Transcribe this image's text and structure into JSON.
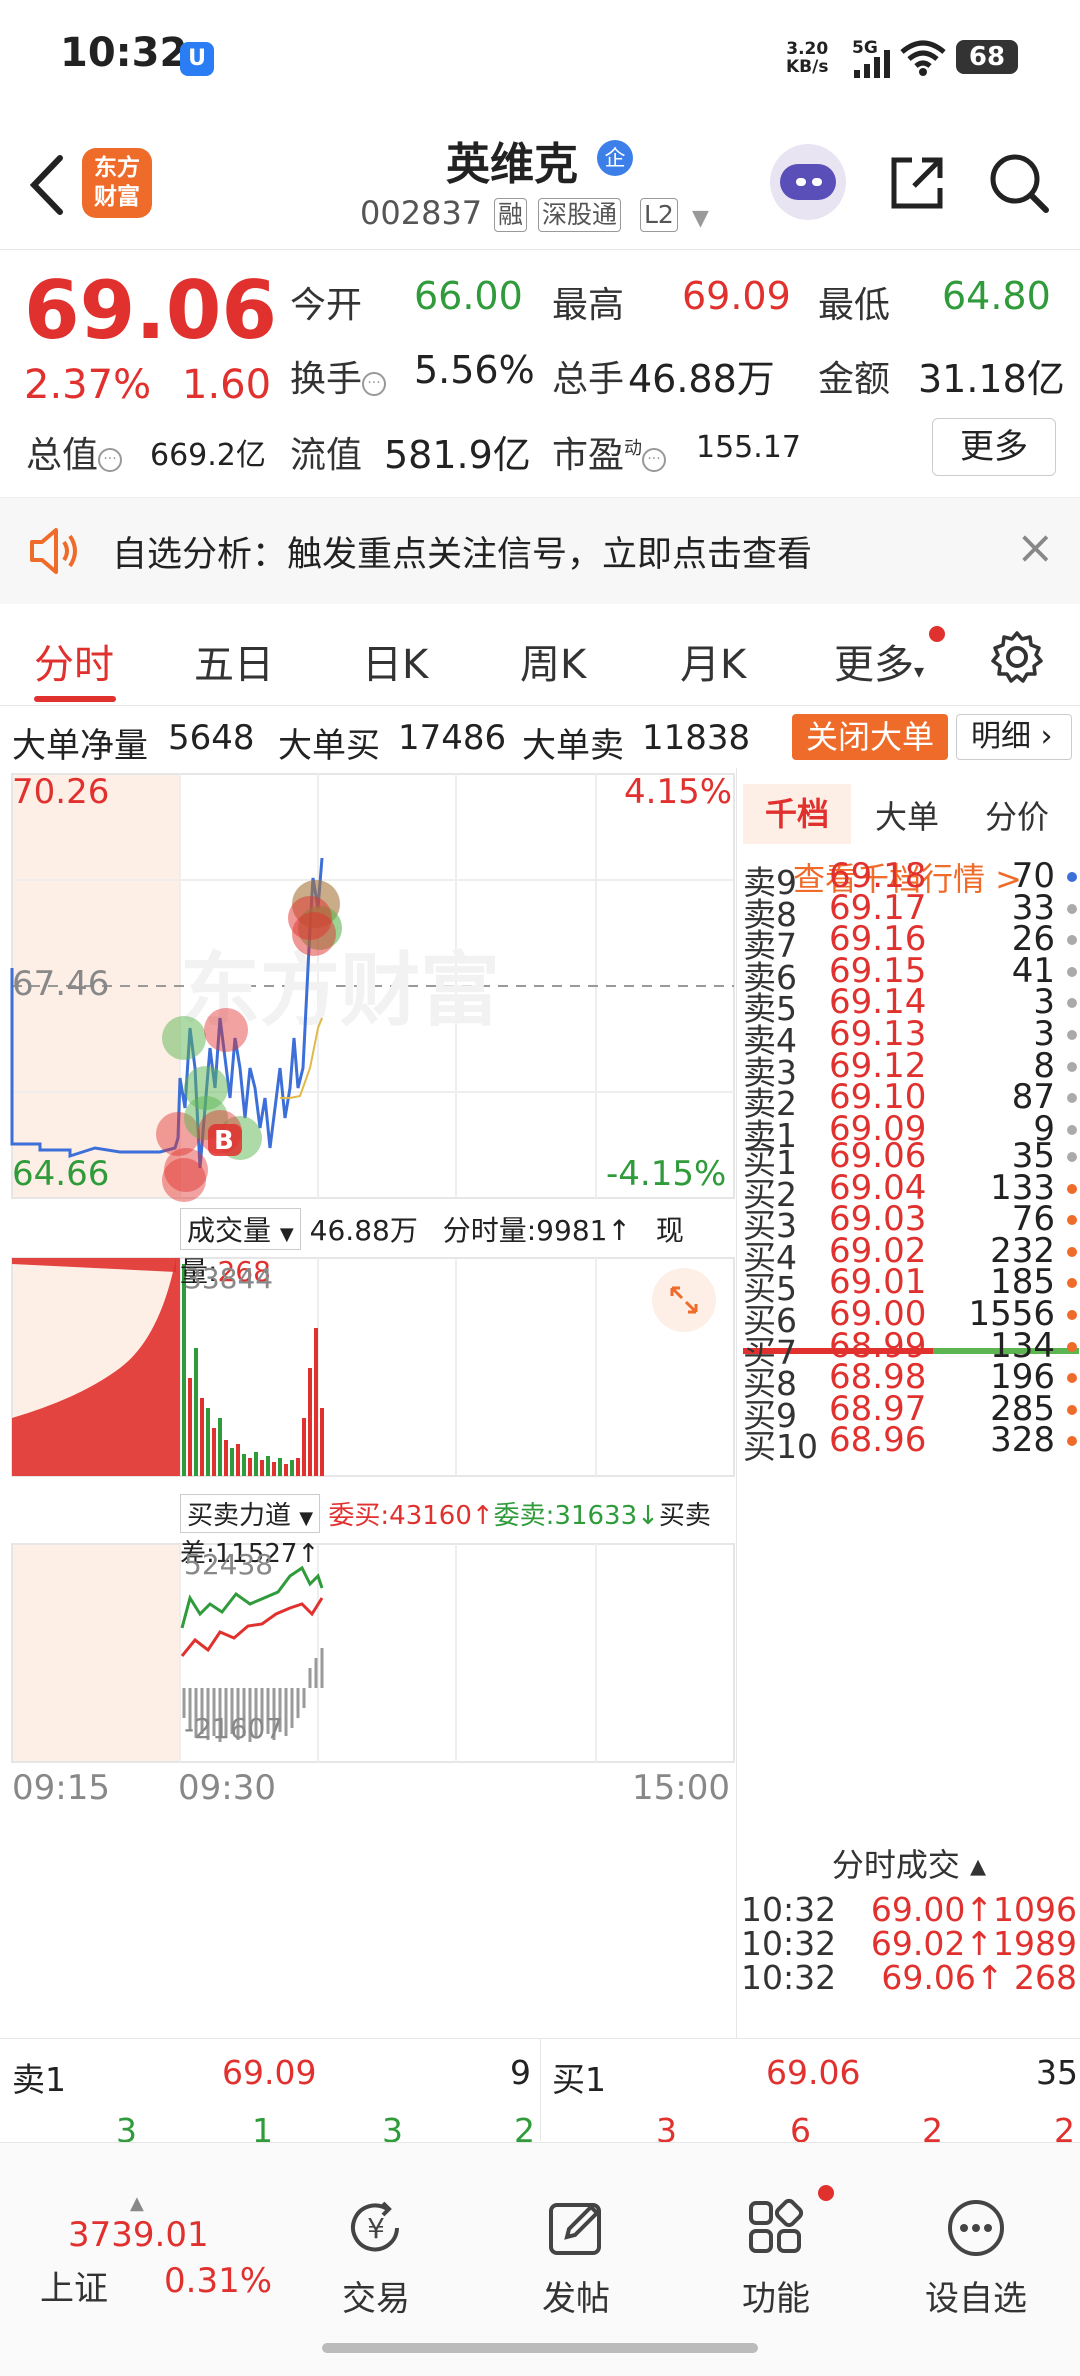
{
  "status_bar": {
    "time": "10:32",
    "net_speed": "3.20",
    "net_unit": "KB/s",
    "signal": "5G",
    "battery": "68"
  },
  "header": {
    "logo_line1": "东方",
    "logo_line2": "财富",
    "stock_name": "英维克",
    "badge": "企",
    "code": "002837",
    "tags": [
      "融",
      "深股通",
      "L2"
    ]
  },
  "quote": {
    "price": "69.06",
    "change_pct": "2.37%",
    "change": "1.60",
    "open_label": "今开",
    "open": "66.00",
    "high_label": "最高",
    "high": "69.09",
    "low_label": "最低",
    "low": "64.80",
    "turnover_label": "换手",
    "turnover": "5.56%",
    "volume_label": "总手",
    "volume": "46.88万",
    "amount_label": "金额",
    "amount": "31.18亿",
    "mcap_label": "总值",
    "mcap": "669.2亿",
    "float_label": "流值",
    "float": "581.9亿",
    "pe_label": "市盈",
    "pe_sup": "动",
    "pe": "155.17",
    "more": "更多"
  },
  "alert": {
    "text": "自选分析：触发重点关注信号，立即点击查看",
    "close": "×"
  },
  "tabs": [
    "分时",
    "五日",
    "日K",
    "周K",
    "月K",
    "更多"
  ],
  "big_order": {
    "net_label": "大单净量",
    "net": "5648",
    "buy_label": "大单买",
    "buy": "17486",
    "sell_label": "大单卖",
    "sell": "11838",
    "close_btn": "关闭大单",
    "detail_btn": "明细"
  },
  "chart": {
    "y_top": "70.26",
    "y_mid": "67.46",
    "y_bot": "64.66",
    "pct_top": "4.15%",
    "pct_bot": "-4.15%",
    "watermark": "东方财富",
    "marker_b": "B",
    "vol_selector": "成交量",
    "vol_total": "46.88万",
    "vol_minute": "分时量:9981↑",
    "vol_now_label": "现量:",
    "vol_now": "268",
    "vol_max": "33844",
    "force_selector": "买卖力道",
    "force_buy": "委买:43160↑",
    "force_sell": "委卖:31633↓",
    "force_diff": "买卖差:11527↑",
    "force_max": "52438",
    "force_min": "-21607",
    "time_start": "09:15",
    "time_open": "09:30",
    "time_end": "15:00"
  },
  "book": {
    "tabs": [
      "千档",
      "大单",
      "分价"
    ],
    "view_link": "查看千档行情 >",
    "asks": [
      {
        "label": "卖9",
        "price": "69.18",
        "qty": "70",
        "dot": "#3c6fd8"
      },
      {
        "label": "卖8",
        "price": "69.17",
        "qty": "33",
        "dot": "#aaaaaa"
      },
      {
        "label": "卖7",
        "price": "69.16",
        "qty": "26",
        "dot": "#aaaaaa"
      },
      {
        "label": "卖6",
        "price": "69.15",
        "qty": "41",
        "dot": "#aaaaaa"
      },
      {
        "label": "卖5",
        "price": "69.14",
        "qty": "3",
        "dot": "#aaaaaa"
      },
      {
        "label": "卖4",
        "price": "69.13",
        "qty": "3",
        "dot": "#aaaaaa"
      },
      {
        "label": "卖3",
        "price": "69.12",
        "qty": "8",
        "dot": "#aaaaaa"
      },
      {
        "label": "卖2",
        "price": "69.10",
        "qty": "87",
        "dot": "#aaaaaa"
      },
      {
        "label": "卖1",
        "price": "69.09",
        "qty": "9",
        "dot": "#aaaaaa"
      }
    ],
    "bids": [
      {
        "label": "买1",
        "price": "69.06",
        "qty": "35",
        "dot": "#aaaaaa"
      },
      {
        "label": "买2",
        "price": "69.04",
        "qty": "133",
        "dot": "#ef6b2a"
      },
      {
        "label": "买3",
        "price": "69.03",
        "qty": "76",
        "dot": "#ef6b2a"
      },
      {
        "label": "买4",
        "price": "69.02",
        "qty": "232",
        "dot": "#ef6b2a"
      },
      {
        "label": "买5",
        "price": "69.01",
        "qty": "185",
        "dot": "#ef6b2a"
      },
      {
        "label": "买6",
        "price": "69.00",
        "qty": "1556",
        "dot": "#ef6b2a"
      },
      {
        "label": "买7",
        "price": "68.99",
        "qty": "134",
        "dot": "#ef6b2a"
      },
      {
        "label": "买8",
        "price": "68.98",
        "qty": "196",
        "dot": "#ef6b2a"
      },
      {
        "label": "买9",
        "price": "68.97",
        "qty": "285",
        "dot": "#ef6b2a"
      },
      {
        "label": "买10",
        "price": "68.96",
        "qty": "328",
        "dot": "#ef6b2a"
      }
    ],
    "trades_title": "分时成交 ▴",
    "trades": [
      {
        "time": "10:32",
        "detail": "69.00↑1096"
      },
      {
        "time": "10:32",
        "detail": "69.02↑1989"
      },
      {
        "time": "10:32",
        "detail": "69.06↑ 268"
      }
    ]
  },
  "level1": {
    "ask_label": "卖1",
    "ask_price": "69.09",
    "ask_qty": "9",
    "bid_label": "买1",
    "bid_price": "69.06",
    "bid_qty": "35",
    "ask_counts": [
      "3",
      "1",
      "3",
      "2"
    ],
    "bid_counts": [
      "3",
      "6",
      "2",
      "2"
    ]
  },
  "nav": {
    "index_value": "3739.01",
    "index_name": "上证",
    "index_pct": "0.31%",
    "items": [
      "交易",
      "发帖",
      "功能",
      "设自选"
    ]
  }
}
